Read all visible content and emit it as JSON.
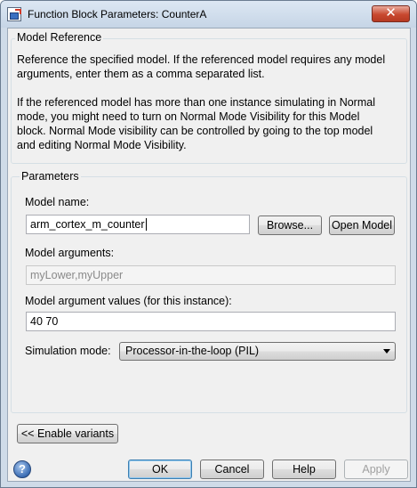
{
  "window": {
    "title": "Function Block Parameters: CounterA",
    "close_glyph": "✕"
  },
  "model_reference": {
    "legend": "Model Reference",
    "paragraph1_line1": "Reference the specified model. If the referenced model requires any model",
    "paragraph1_line2": "arguments, enter them as a comma separated list.",
    "paragraph2_line1": "If the referenced model has more than one instance simulating in Normal",
    "paragraph2_line2": "mode, you might need to turn on Normal Mode Visibility for this Model",
    "paragraph2_line3": "block. Normal Mode visibility can be controlled by going to the top model",
    "paragraph2_line4": "and editing Normal Mode Visibility."
  },
  "parameters": {
    "legend": "Parameters",
    "model_name_label": "Model name:",
    "model_name_value": "arm_cortex_m_counter",
    "browse_label": "Browse...",
    "open_model_label": "Open Model",
    "model_arguments_label": "Model arguments:",
    "model_arguments_value": "myLower,myUpper",
    "arg_values_label": "Model argument values (for this instance):",
    "arg_values_value": "40 70",
    "sim_mode_label": "Simulation mode:",
    "sim_mode_value": "Processor-in-the-loop (PIL)"
  },
  "enable_variants_label": "<< Enable variants",
  "footer": {
    "help_glyph": "?",
    "ok_label": "OK",
    "cancel_label": "Cancel",
    "help_label": "Help",
    "apply_label": "Apply"
  },
  "icons": {
    "app": "simulink-block-icon",
    "close": "close-icon",
    "help": "help-icon",
    "dropdown": "chevron-down-icon"
  }
}
